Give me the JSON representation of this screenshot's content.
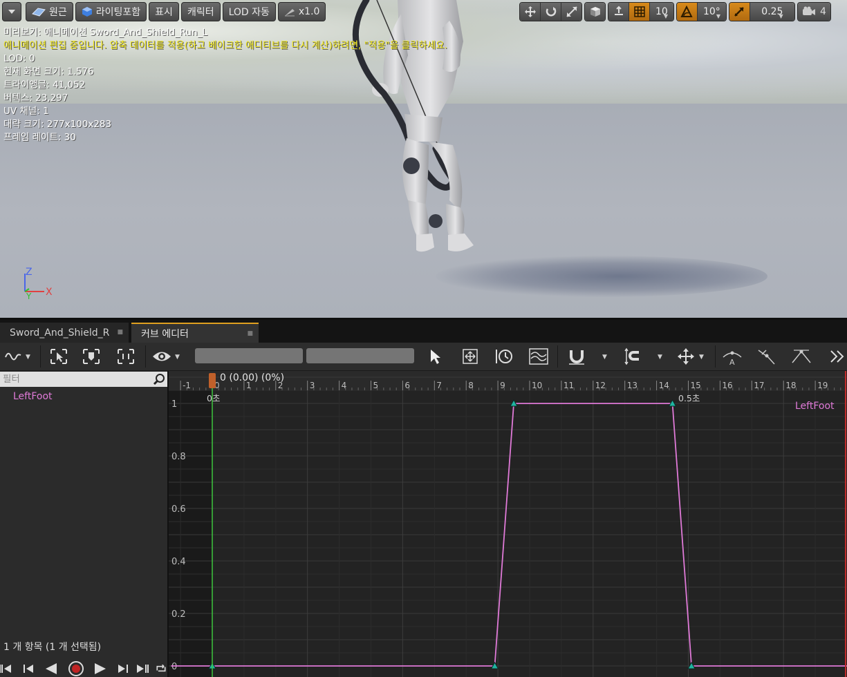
{
  "viewport": {
    "toolbar_left": {
      "menu_icon": "chevron-down-icon",
      "perspective_label": "원근",
      "lighting_label": "라이팅포함",
      "show_label": "표시",
      "character_label": "캐릭터",
      "lod_label": "LOD 자동",
      "speed_label": "x1.0"
    },
    "toolbar_right": {
      "grid_snap_value": "10",
      "rotation_snap_value": "10°",
      "scale_snap_value": "0.25",
      "camera_speed_value": "4"
    },
    "stats": {
      "preview": "미리보기: 애니메이션 Sword_And_Shield_Run_L",
      "warning": "애니메이션 편집 중입니다. 압축 데이터를 적용(하고 베이크한 애디티브를 다시 계산)하려면, \"적용\"을 클릭하세요.",
      "lod": "LOD: 0",
      "screen_size": "현재 화면 크기: 1.576",
      "triangles": "트라이앵글: 41,052",
      "vertices": "버텍스: 23,297",
      "uv_channels": "UV 채널: 1",
      "approx_size": "대략 크기: 277x100x283",
      "frame_rate": "프레임 레이트: 30"
    },
    "axes": {
      "z": "Z",
      "y": "Y",
      "x": "X"
    }
  },
  "tabs": [
    {
      "label": "Sword_And_Shield_R"
    },
    {
      "label": "커브 에디터"
    }
  ],
  "curve_panel": {
    "filter_placeholder": "필터",
    "curve_name": "LeftFoot",
    "item_count": "1 개 항목 (1 개 선택됨)"
  },
  "graph": {
    "playhead_label": "0 (0.00) (0%)",
    "time_marker_start": "0초",
    "time_marker_mid": "0.5초",
    "curve_label": "LeftFoot",
    "curve_color": "#e07ad8",
    "playhead_color": "#c0602a",
    "frame_ticks": [
      "-1",
      "0",
      "1",
      "2",
      "3",
      "4",
      "5",
      "6",
      "7",
      "8",
      "9",
      "10",
      "11",
      "12",
      "13",
      "14",
      "15",
      "16",
      "17",
      "18",
      "19"
    ],
    "y_ticks": [
      "1",
      "0.8",
      "0.6",
      "0.4",
      "0.2",
      "0"
    ],
    "keys": [
      {
        "frame": 0,
        "value": 0
      },
      {
        "frame": 8.9,
        "value": 0
      },
      {
        "frame": 9.5,
        "value": 1
      },
      {
        "frame": 14.5,
        "value": 1
      },
      {
        "frame": 15.1,
        "value": 0
      }
    ]
  }
}
